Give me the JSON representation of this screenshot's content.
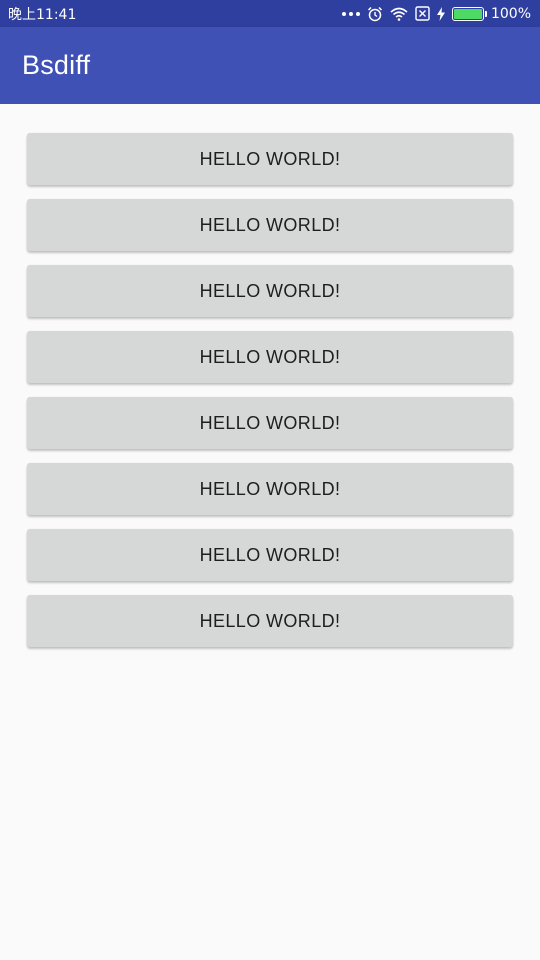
{
  "status_bar": {
    "time": "晚上11:41",
    "battery_percent": "100%",
    "battery_level": 1.0,
    "icons": [
      "more-dots-icon",
      "alarm-icon",
      "wifi-icon",
      "no-sim-icon",
      "charging-bolt-icon",
      "battery-icon"
    ],
    "background_color": "#2f3f9f"
  },
  "app_bar": {
    "title": "Bsdiff",
    "background_color": "#3f51b5"
  },
  "buttons": [
    {
      "label": "HELLO WORLD!"
    },
    {
      "label": "HELLO WORLD!"
    },
    {
      "label": "HELLO WORLD!"
    },
    {
      "label": "HELLO WORLD!"
    },
    {
      "label": "HELLO WORLD!"
    },
    {
      "label": "HELLO WORLD!"
    },
    {
      "label": "HELLO WORLD!"
    },
    {
      "label": "HELLO WORLD!"
    }
  ],
  "colors": {
    "button_background": "#d6d7d7",
    "content_background": "#fafafa"
  }
}
